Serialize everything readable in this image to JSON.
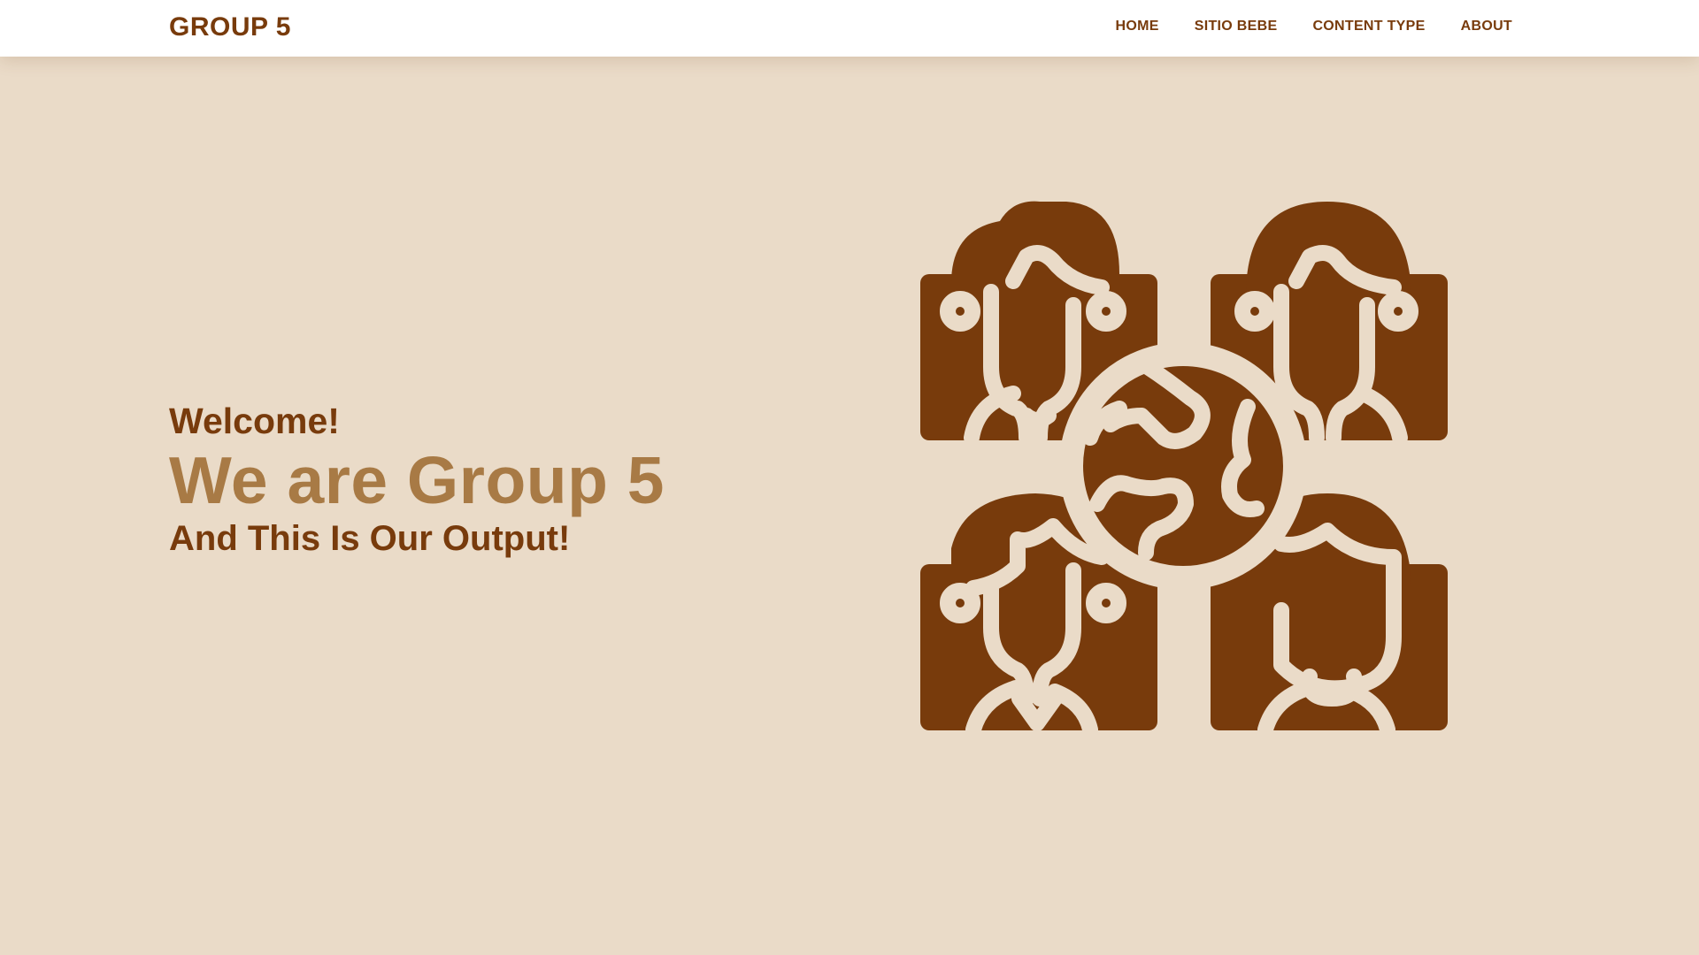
{
  "navbar": {
    "brand": "GROUP 5",
    "links": [
      {
        "label": "HOME"
      },
      {
        "label": "SITIO BEBE"
      },
      {
        "label": "CONTENT TYPE"
      },
      {
        "label": "ABOUT"
      }
    ]
  },
  "hero": {
    "welcome": "Welcome!",
    "headline": "We are Group 5",
    "subline": "And This Is Our Output!",
    "illustration_icon": "team-globe-icon"
  },
  "colors": {
    "background": "#eadbc8",
    "primary_brown": "#783b0c",
    "accent_tan": "#a87a45",
    "navbar_bg": "#ffffff"
  }
}
